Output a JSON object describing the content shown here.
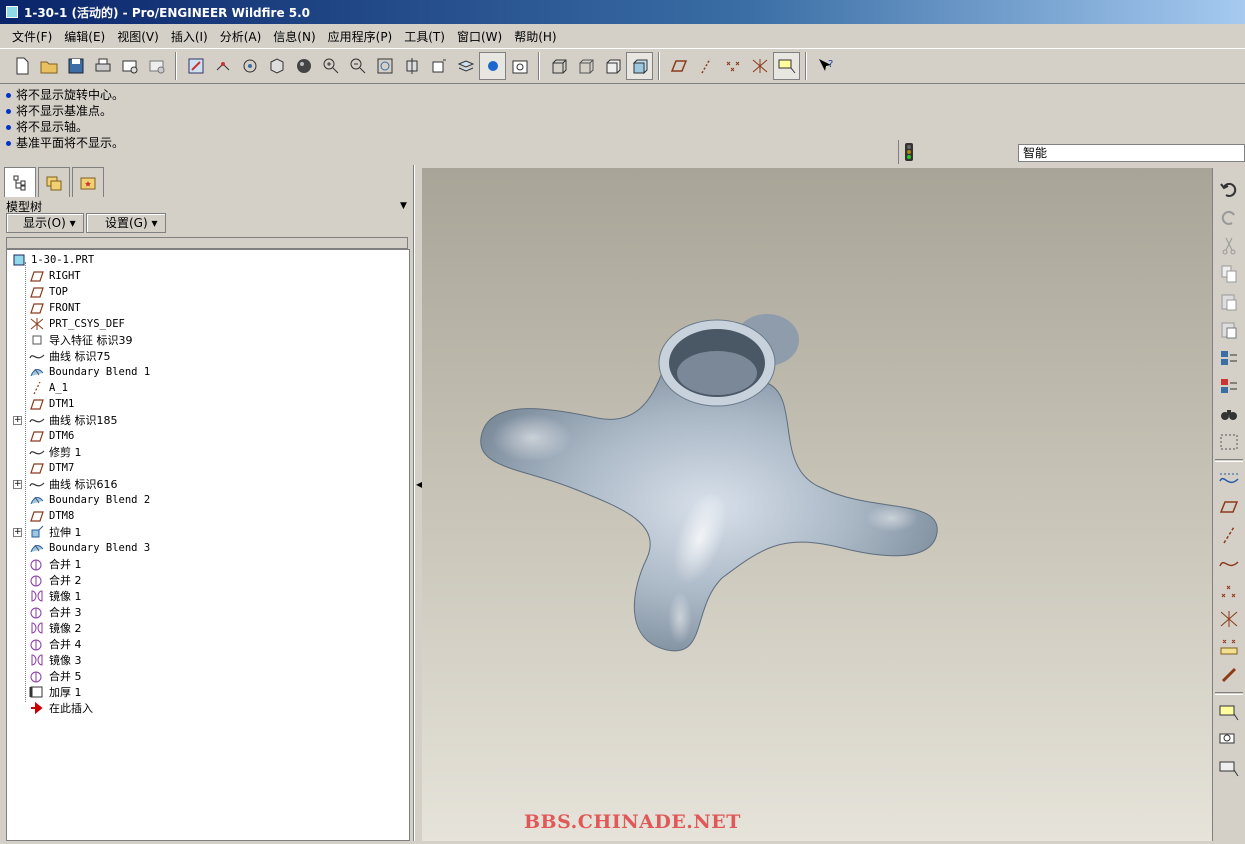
{
  "window": {
    "title": "1-30-1 (活动的) - Pro/ENGINEER Wildfire 5.0"
  },
  "menubar": {
    "items": [
      "文件(F)",
      "编辑(E)",
      "视图(V)",
      "插入(I)",
      "分析(A)",
      "信息(N)",
      "应用程序(P)",
      "工具(T)",
      "窗口(W)",
      "帮助(H)"
    ]
  },
  "messages": [
    "将不显示旋转中心。",
    "将不显示基准点。",
    "将不显示轴。",
    "基准平面将不显示。"
  ],
  "filter": {
    "value": "智能"
  },
  "model_tree": {
    "title": "模型树",
    "show_button": "显示(O) ▾",
    "settings_button": "设置(G) ▾",
    "root": "1-30-1.PRT",
    "items": [
      {
        "label": "RIGHT",
        "icon": "datum-plane-icon",
        "expandable": false,
        "mono": true
      },
      {
        "label": "TOP",
        "icon": "datum-plane-icon",
        "expandable": false,
        "mono": true
      },
      {
        "label": "FRONT",
        "icon": "datum-plane-icon",
        "expandable": false,
        "mono": true
      },
      {
        "label": "PRT_CSYS_DEF",
        "icon": "csys-icon",
        "expandable": false,
        "mono": true
      },
      {
        "label": "导入特征 标识39",
        "icon": "import-feature-icon",
        "expandable": false,
        "mono": false
      },
      {
        "label": "曲线 标识75",
        "icon": "curve-icon",
        "expandable": false,
        "mono": false
      },
      {
        "label": "Boundary Blend 1",
        "icon": "boundary-blend-icon",
        "expandable": false,
        "mono": true
      },
      {
        "label": "A_1",
        "icon": "datum-axis-icon",
        "expandable": false,
        "mono": true
      },
      {
        "label": "DTM1",
        "icon": "datum-plane-icon",
        "expandable": false,
        "mono": true
      },
      {
        "label": "曲线 标识185",
        "icon": "curve-icon",
        "expandable": true,
        "mono": false
      },
      {
        "label": "DTM6",
        "icon": "datum-plane-icon",
        "expandable": false,
        "mono": true
      },
      {
        "label": "修剪 1",
        "icon": "curve-icon",
        "expandable": false,
        "mono": false
      },
      {
        "label": "DTM7",
        "icon": "datum-plane-icon",
        "expandable": false,
        "mono": true
      },
      {
        "label": "曲线 标识616",
        "icon": "curve-icon",
        "expandable": true,
        "mono": false
      },
      {
        "label": "Boundary Blend 2",
        "icon": "boundary-blend-icon",
        "expandable": false,
        "mono": true
      },
      {
        "label": "DTM8",
        "icon": "datum-plane-icon",
        "expandable": false,
        "mono": true
      },
      {
        "label": "拉伸 1",
        "icon": "extrude-icon",
        "expandable": true,
        "mono": false
      },
      {
        "label": "Boundary Blend 3",
        "icon": "boundary-blend-icon",
        "expandable": false,
        "mono": true
      },
      {
        "label": "合并 1",
        "icon": "merge-icon",
        "expandable": false,
        "mono": false
      },
      {
        "label": "合并 2",
        "icon": "merge-icon",
        "expandable": false,
        "mono": false
      },
      {
        "label": "镜像 1",
        "icon": "mirror-icon",
        "expandable": false,
        "mono": false
      },
      {
        "label": "合并 3",
        "icon": "merge-icon",
        "expandable": false,
        "mono": false
      },
      {
        "label": "镜像 2",
        "icon": "mirror-icon",
        "expandable": false,
        "mono": false
      },
      {
        "label": "合并 4",
        "icon": "merge-icon",
        "expandable": false,
        "mono": false
      },
      {
        "label": "镜像 3",
        "icon": "mirror-icon",
        "expandable": false,
        "mono": false
      },
      {
        "label": "合并 5",
        "icon": "merge-icon",
        "expandable": false,
        "mono": false
      },
      {
        "label": "加厚 1",
        "icon": "thicken-icon",
        "expandable": false,
        "mono": false
      },
      {
        "label": "在此插入",
        "icon": "insert-here-arrow-icon",
        "expandable": false,
        "mono": false
      }
    ]
  },
  "watermark": "BBS.CHINADE.NET",
  "colors": {
    "title_bar": "#0a246a",
    "viewport_top": "#a8a497",
    "viewport_bottom": "#e6e3da",
    "watermark": "#e05858",
    "model_surface": "#b8c4d0"
  }
}
